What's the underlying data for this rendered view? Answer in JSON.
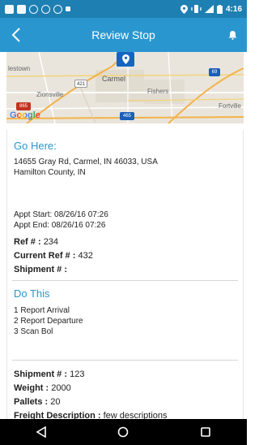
{
  "status_bar": {
    "time": "4:16"
  },
  "app_bar": {
    "title": "Review Stop"
  },
  "map": {
    "labels": {
      "westown": "lestown",
      "carmel": "Carmel",
      "fishers": "Fishers",
      "zionsville": "Zionsville",
      "fortville": "Fortville",
      "road_865": "865",
      "road_69": "69",
      "road_421": "421",
      "road_465": "465",
      "google": "Google"
    }
  },
  "go_here": {
    "title": "Go Here:",
    "address_line1": "14655 Gray Rd, Carmel, IN 46033, USA",
    "address_line2": "Hamilton County, IN",
    "appt_start": "Appt Start: 08/26/16 07:26",
    "appt_end": "Appt End: 08/26/16 07:26",
    "ref_label": "Ref # :",
    "ref_value": "234",
    "current_ref_label": "Current Ref # :",
    "current_ref_value": "432",
    "shipment_label": "Shipment # :",
    "shipment_value": ""
  },
  "do_this": {
    "title": "Do This",
    "items": [
      "1 Report Arrival",
      "2 Report Departure",
      "3 Scan Bol"
    ]
  },
  "shipment": {
    "shipment_label": "Shipment # :",
    "shipment_value": "123",
    "weight_label": "Weight :",
    "weight_value": "2000",
    "pallets_label": "Pallets :",
    "pallets_value": "20",
    "freight_label": "Freight Description :",
    "freight_value": "few descriptions"
  },
  "colors": {
    "status_bar": "#1e7fb3",
    "app_bar": "#2a96cf",
    "accent": "#2a96cf",
    "map_pin": "#1565c0"
  }
}
